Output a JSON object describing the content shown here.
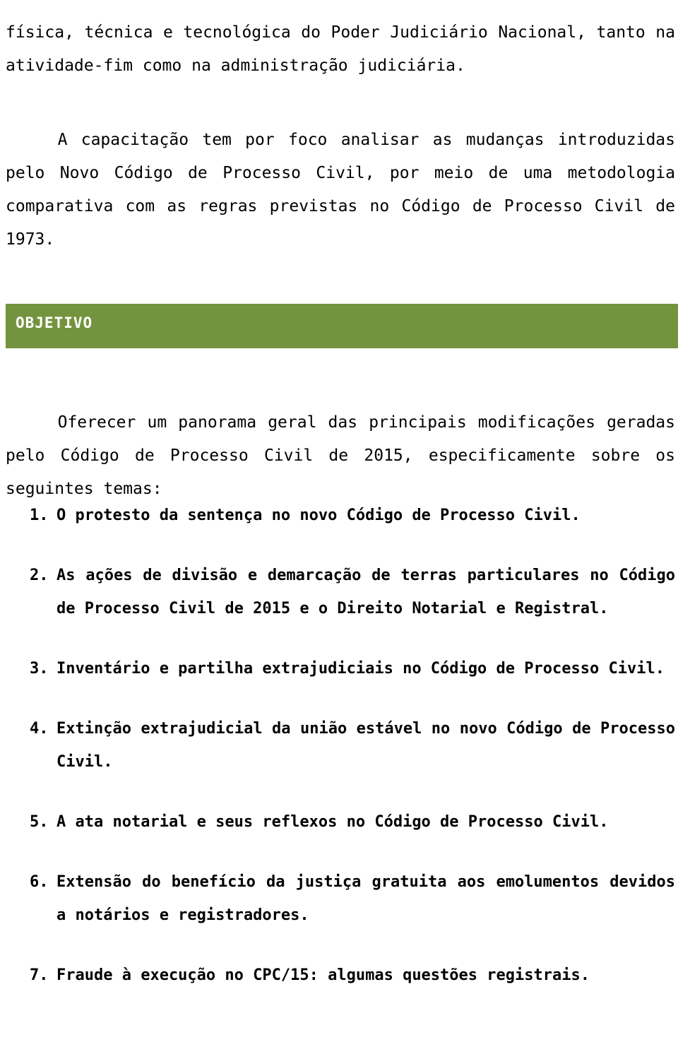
{
  "document": {
    "language": "pt-BR",
    "paragraphs": {
      "continuation": "física, técnica e tecnológica do Poder Judiciário Nacional, tanto na atividade-fim como na administração judiciária.",
      "capacitacao": "A capacitação tem por foco analisar as mudanças introduzidas pelo Novo Código de Processo Civil, por meio de uma metodologia comparativa com as regras previstas no Código de Processo Civil de 1973.",
      "oferecer": "Oferecer um panorama geral das principais modificações geradas pelo Código de Processo Civil de 2015, especificamente sobre os seguintes temas:"
    },
    "section": {
      "title": "OBJETIVO",
      "bar_color": "#74933E",
      "title_color": "#FFFFFF"
    },
    "topics": [
      {
        "number": "1.",
        "text": "O protesto da sentença no novo Código de Processo Civil."
      },
      {
        "number": "2.",
        "text": "As ações de divisão e demarcação de terras particulares no Código de Processo Civil de 2015 e o Direito Notarial e Registral."
      },
      {
        "number": "3.",
        "text": "Inventário e partilha extrajudiciais no Código de Processo Civil."
      },
      {
        "number": "4.",
        "text": "Extinção extrajudicial da união estável no novo Código de Processo Civil."
      },
      {
        "number": "5.",
        "text": "A ata notarial e seus reflexos no Código de Processo Civil."
      },
      {
        "number": "6.",
        "text": "Extensão do benefício da justiça gratuita aos emolumentos devidos a notários e registradores."
      },
      {
        "number": "7.",
        "text": "Fraude à execução no CPC/15: algumas questões registrais."
      }
    ]
  }
}
